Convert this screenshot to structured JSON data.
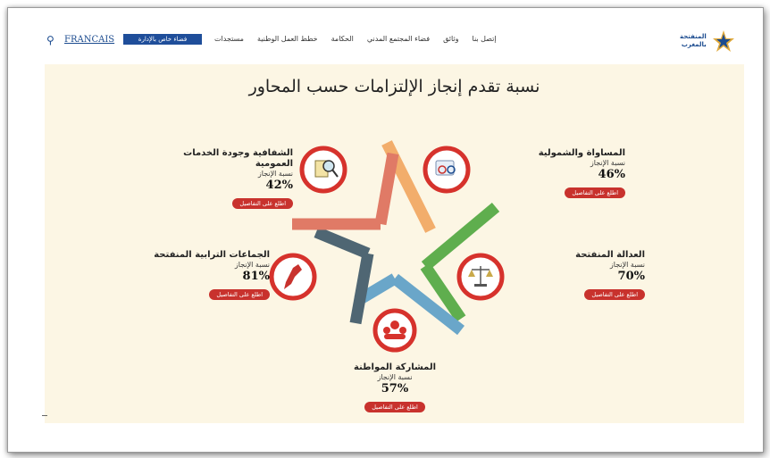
{
  "header": {
    "lang_label": "FRANCAIS",
    "cta_label": "فضاء خاص بالإدارة",
    "nav": [
      "مستجدات",
      "خطط العمل الوطنية",
      "الحكامة",
      "فضاء المجتمع المدني",
      "وثائق",
      "إتصل بنا"
    ],
    "logo_lines": [
      "المنفتحة",
      "بالمغرب"
    ]
  },
  "main": {
    "title": "نسبة تقدم إنجاز الإلتزامات حسب المحاور",
    "progress_label": "نسبة الإنجاز",
    "details_label": "اطلع على التفاصيل",
    "axes": [
      {
        "name": "المساواة والشمولية",
        "name2": "",
        "percent": "46%",
        "value": 46,
        "icon": "people-gender-icon"
      },
      {
        "name": "الشفافية وجودة الخدمات",
        "name2": "العمومية",
        "percent": "42%",
        "value": 42,
        "icon": "magnifier-document-icon"
      },
      {
        "name": "العدالة المنفتحة",
        "name2": "",
        "percent": "70%",
        "value": 70,
        "icon": "scales-justice-icon"
      },
      {
        "name": "الجماعات الترابية المنفتحة",
        "name2": "",
        "percent": "81%",
        "value": 81,
        "icon": "morocco-map-icon"
      },
      {
        "name": "المشاركة المواطنة",
        "name2": "",
        "percent": "57%",
        "value": 57,
        "icon": "citizens-group-icon"
      }
    ]
  },
  "colors": {
    "star_orange": "#f2ad6b",
    "star_green": "#5fae4e",
    "star_blue": "#6aa6c9",
    "star_slate": "#4f6673",
    "star_salmon": "#e07a66",
    "ring": "#d6322c",
    "button": "#c8322d",
    "panel": "#fcf6e4"
  }
}
